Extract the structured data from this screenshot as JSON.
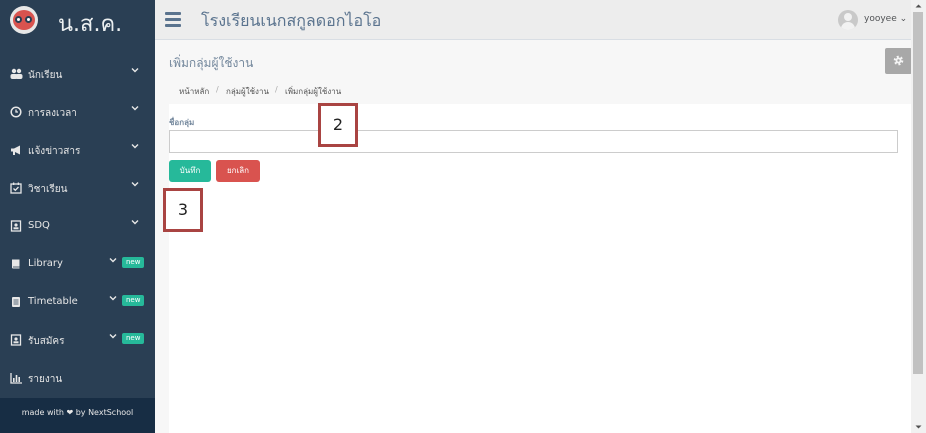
{
  "brand": {
    "title": "น.ส.ค."
  },
  "header": {
    "school_name": "โรงเรียนเนกสกูลดอกไอโอ",
    "username": "yooyee",
    "user_caret": "⌄"
  },
  "sidebar": {
    "items": [
      {
        "label": "นักเรียน",
        "icon": "users-icon",
        "glyph": "👥"
      },
      {
        "label": "การลงเวลา",
        "icon": "clock-icon",
        "glyph": "◷"
      },
      {
        "label": "แจ้งข่าวสาร",
        "icon": "megaphone-icon",
        "glyph": "📢"
      },
      {
        "label": "วิชาเรียน",
        "icon": "calendar-check-icon",
        "glyph": "☑"
      },
      {
        "label": "SDQ",
        "icon": "contact-card-icon",
        "glyph": "▣"
      },
      {
        "label": "Library",
        "icon": "book-icon",
        "glyph": "📖",
        "badge": "new"
      },
      {
        "label": "Timetable",
        "icon": "timetable-icon",
        "glyph": "▤",
        "badge": "new"
      },
      {
        "label": "รับสมัคร",
        "icon": "application-icon",
        "glyph": "▣",
        "badge": "new"
      },
      {
        "label": "รายงาน",
        "icon": "bar-chart-icon",
        "glyph": "📊"
      }
    ],
    "footer": "made with ❤ by NextSchool"
  },
  "page": {
    "title": "เพิ่มกลุ่มผู้ใช้งาน",
    "breadcrumb": [
      "หน้าหลัก",
      "กลุ่มผู้ใช้งาน",
      "เพิ่มกลุ่มผู้ใช้งาน"
    ],
    "breadcrumb_separator": "/"
  },
  "form": {
    "group_name_label": "ชื่อกลุ่ม",
    "group_name_value": "",
    "save_label": "บันทึก",
    "cancel_label": "ยกเลิก"
  },
  "annotations": {
    "box_2": "2",
    "box_3": "3"
  },
  "colors": {
    "sidebar_bg": "#2a3f54",
    "save_button": "#26b99a",
    "cancel_button": "#d9534f",
    "annotation_border": "#a94442"
  }
}
